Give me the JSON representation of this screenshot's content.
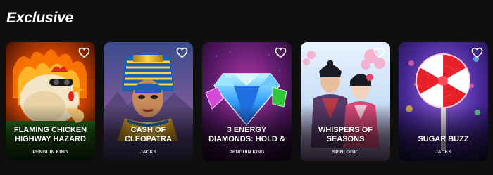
{
  "section": {
    "title": "Exclusive"
  },
  "colors": {
    "background": "#0f0f0f",
    "text": "#ffffff",
    "favorite_outline": "#ffffff"
  },
  "icons": {
    "favorite": "heart-outline-icon"
  },
  "games": [
    {
      "title": "FLAMING CHICKEN HIGHWAY HAZARD",
      "provider": "PENGUIN KING",
      "theme": "flaming-chicken"
    },
    {
      "title": "CASH OF CLEOPATRA",
      "provider": "JACKS",
      "theme": "cleopatra"
    },
    {
      "title": "3 ENERGY DIAMONDS: HOLD &",
      "provider": "PENGUIN KING",
      "theme": "diamonds"
    },
    {
      "title": "WHISPERS OF SEASONS",
      "provider": "SPINLOGIC",
      "theme": "samurai"
    },
    {
      "title": "SUGAR BUZZ",
      "provider": "JACKS",
      "theme": "lollipop"
    }
  ]
}
